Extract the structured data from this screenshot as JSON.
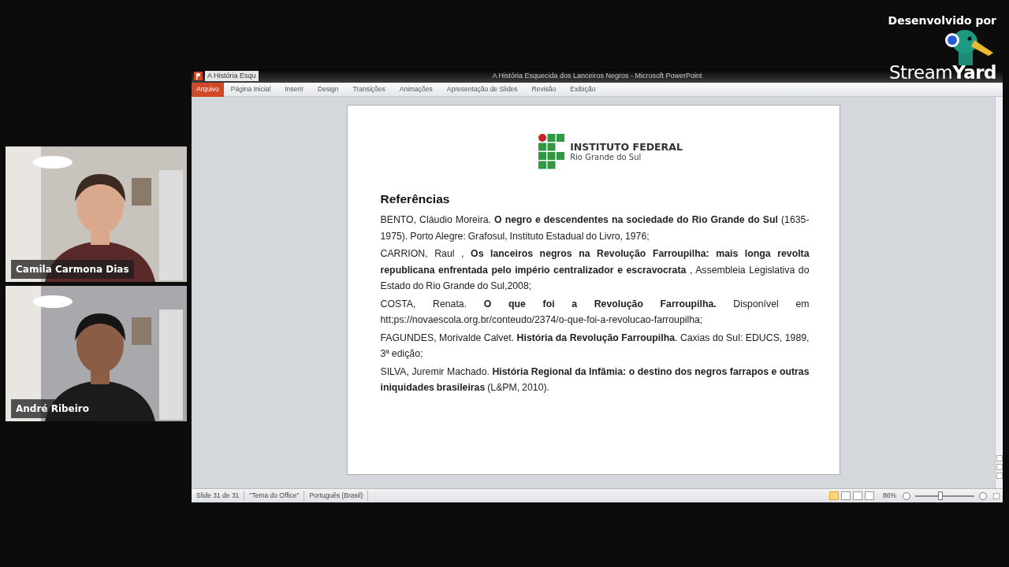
{
  "branding": {
    "caption": "Desenvolvido por",
    "logo_text": "Stream**Yard**"
  },
  "participants": [
    {
      "name": "Camila Carmona Dias",
      "kind": "picture"
    },
    {
      "name": "André Ribeiro",
      "kind": "picture"
    }
  ],
  "window": {
    "doc_tab": "A História Esqu",
    "title": "A História Esquecida dos Lanceiros Negros - Microsoft PowerPoint",
    "ribbon_tabs": [
      {
        "label": "Arquivo",
        "kind": "file",
        "selected": false
      },
      {
        "label": "Página Inicial",
        "kind": "tab",
        "selected": false
      },
      {
        "label": "Inserir",
        "kind": "tab",
        "selected": false
      },
      {
        "label": "Design",
        "kind": "tab",
        "selected": false
      },
      {
        "label": "Transições",
        "kind": "tab",
        "selected": false
      },
      {
        "label": "Animações",
        "kind": "tab",
        "selected": false
      },
      {
        "label": "Apresentação de Slides",
        "kind": "tab",
        "selected": false
      },
      {
        "label": "Revisão",
        "kind": "tab",
        "selected": false
      },
      {
        "label": "Exibição",
        "kind": "tab",
        "selected": false
      }
    ]
  },
  "slide": {
    "org_name": "INSTITUTO FEDERAL",
    "org_sub": "Rio Grande do Sul",
    "heading": "Referências",
    "references": [
      "BENTO, Cláudio Moreira. **O negro e descendentes na sociedade do Rio Grande do Sul** (1635-1975). Porto Alegre: Grafosul, Instituto  Estadual do Livro, 1976;",
      "CARRION, Raul , **Os lanceiros negros na Revolução Farroupilha: mais longa revolta republicana enfrentada pelo império centralizador e escravocrata** , Assembleia Legislativa do Estado  do Rio Grande do Sul,2008;",
      "COSTA, Renata. **O que foi a Revolução Farroupilha.** Disponível em htt;ps://novaescola.org.br/conteudo/2374/o-que-foi-a-revolucao-farroupilha;",
      "FAGUNDES, Morivalde Calvet. **História da Revolução Farroupilha**. Caxias do Sul: EDUCS, 1989, 3ª edição;",
      "SILVA, Juremir Machado. **História Regional da Infâmia: o destino dos negros farrapos e outras iniquidades brasileiras** (L&PM, 2010)."
    ]
  },
  "status_bar": {
    "slide": "Slide 31 de 31",
    "theme": "\"Tema do Office\"",
    "language": "Português (Brasil)",
    "zoom": "86%",
    "views": [
      {
        "selected": true
      },
      {
        "selected": false
      },
      {
        "selected": false
      },
      {
        "selected": false
      }
    ],
    "zoom_slider": {
      "level": 0.42
    }
  }
}
